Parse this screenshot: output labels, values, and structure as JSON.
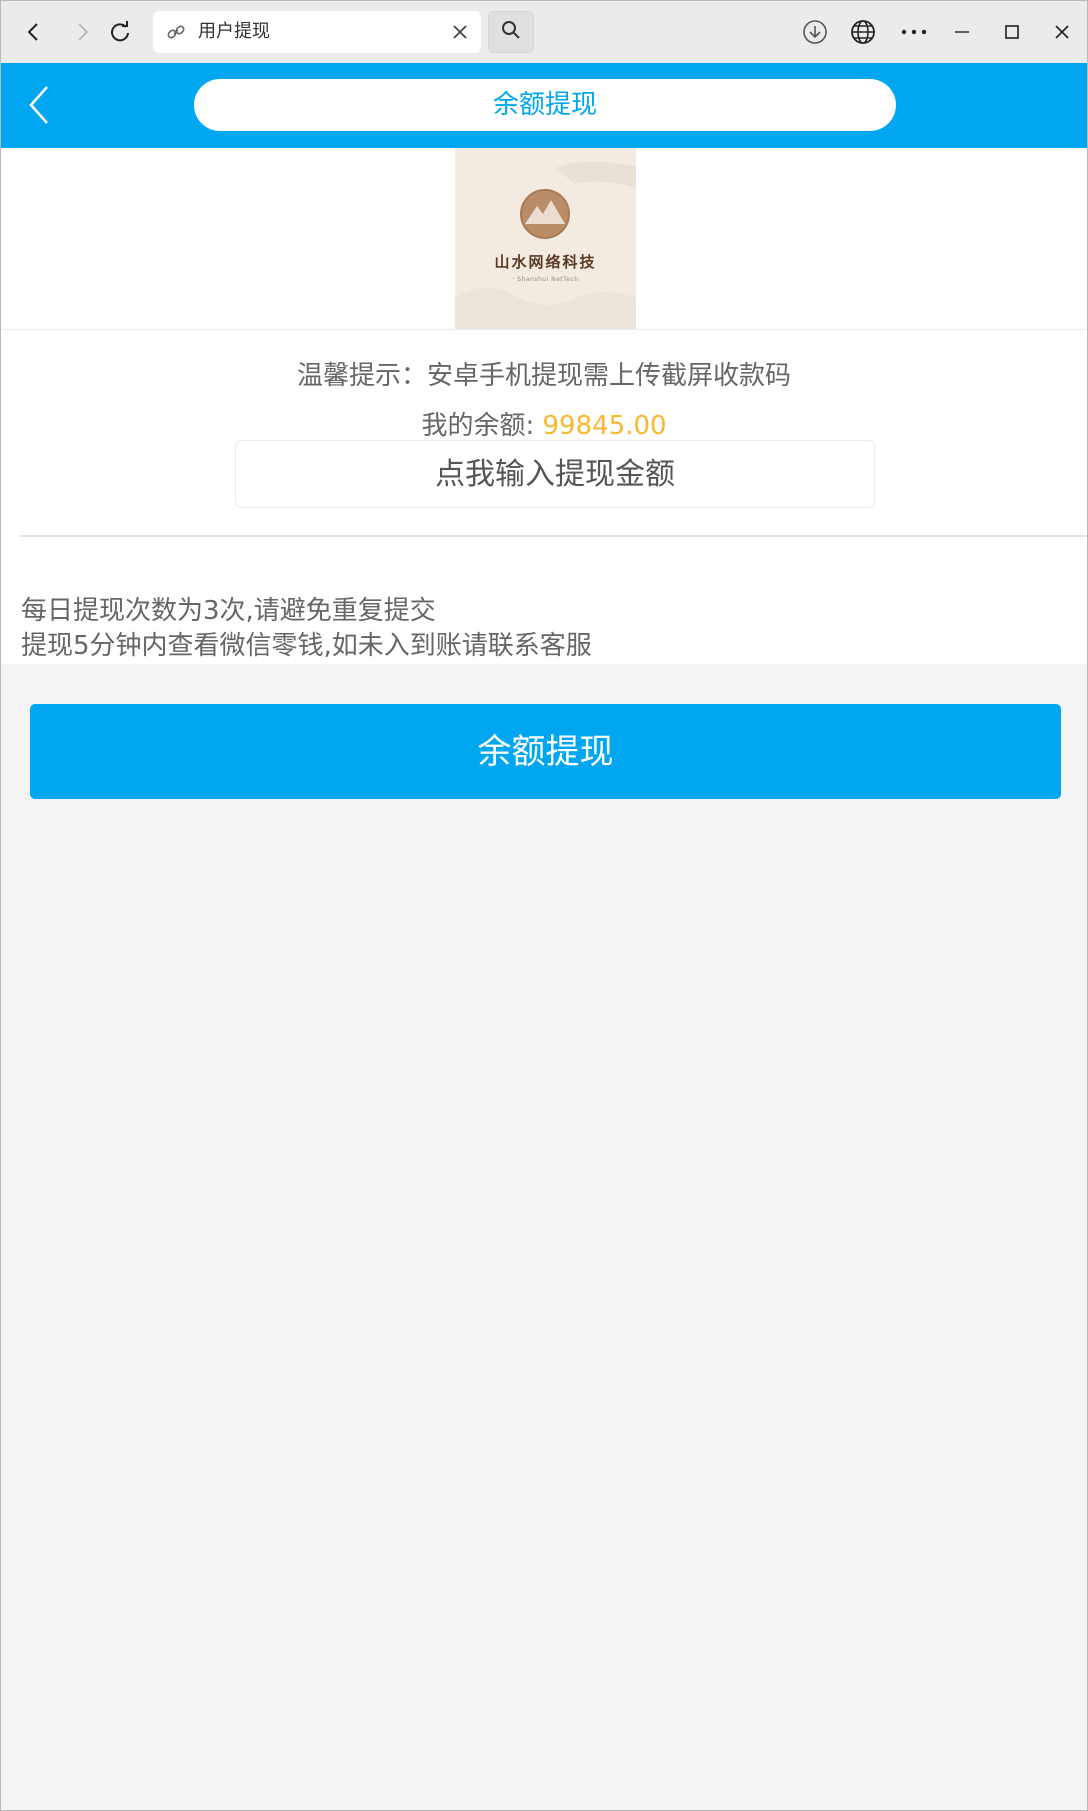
{
  "browser": {
    "tab_title": "用户提现",
    "icons": [
      "back-arrow-icon",
      "forward-arrow-icon",
      "reload-icon",
      "link-icon",
      "close-icon",
      "search-icon",
      "download-icon",
      "globe-icon",
      "more-icon",
      "minimize-icon",
      "maximize-icon",
      "window-close-icon"
    ]
  },
  "header": {
    "title": "余额提现",
    "accent_color": "#00a7f0"
  },
  "logo": {
    "brand_text": "山水网络科技",
    "brand_sub": "· Shanshui NetTech"
  },
  "tip": {
    "text": "温馨提示：安卓手机提现需上传截屏收款码"
  },
  "balance": {
    "label": "我的余额: ",
    "amount": "99845.00",
    "amount_color": "#f8b830"
  },
  "amount_input": {
    "placeholder": "点我输入提现金额",
    "value": ""
  },
  "notes": {
    "line1": "每日提现次数为3次,请避免重复提交",
    "line2": "提现5分钟内查看微信零钱,如未入到账请联系客服"
  },
  "submit": {
    "label": "余额提现"
  }
}
